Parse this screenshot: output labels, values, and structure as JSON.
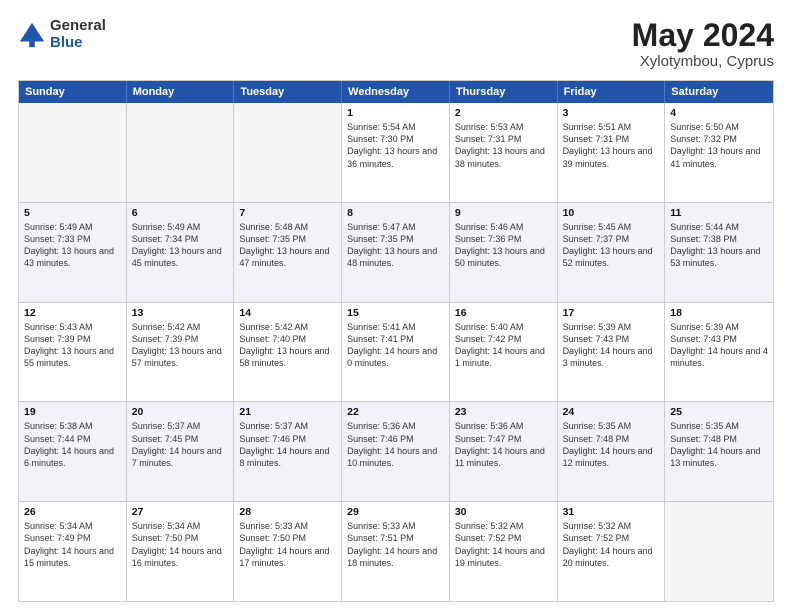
{
  "logo": {
    "general": "General",
    "blue": "Blue"
  },
  "title": {
    "month": "May 2024",
    "location": "Xylotymbou, Cyprus"
  },
  "header_days": [
    "Sunday",
    "Monday",
    "Tuesday",
    "Wednesday",
    "Thursday",
    "Friday",
    "Saturday"
  ],
  "rows": [
    {
      "alt": false,
      "cells": [
        {
          "day": "",
          "sunrise": "",
          "sunset": "",
          "daylight": "",
          "empty": true
        },
        {
          "day": "",
          "sunrise": "",
          "sunset": "",
          "daylight": "",
          "empty": true
        },
        {
          "day": "",
          "sunrise": "",
          "sunset": "",
          "daylight": "",
          "empty": true
        },
        {
          "day": "1",
          "sunrise": "Sunrise: 5:54 AM",
          "sunset": "Sunset: 7:30 PM",
          "daylight": "Daylight: 13 hours and 36 minutes.",
          "empty": false
        },
        {
          "day": "2",
          "sunrise": "Sunrise: 5:53 AM",
          "sunset": "Sunset: 7:31 PM",
          "daylight": "Daylight: 13 hours and 38 minutes.",
          "empty": false
        },
        {
          "day": "3",
          "sunrise": "Sunrise: 5:51 AM",
          "sunset": "Sunset: 7:31 PM",
          "daylight": "Daylight: 13 hours and 39 minutes.",
          "empty": false
        },
        {
          "day": "4",
          "sunrise": "Sunrise: 5:50 AM",
          "sunset": "Sunset: 7:32 PM",
          "daylight": "Daylight: 13 hours and 41 minutes.",
          "empty": false
        }
      ]
    },
    {
      "alt": true,
      "cells": [
        {
          "day": "5",
          "sunrise": "Sunrise: 5:49 AM",
          "sunset": "Sunset: 7:33 PM",
          "daylight": "Daylight: 13 hours and 43 minutes.",
          "empty": false
        },
        {
          "day": "6",
          "sunrise": "Sunrise: 5:49 AM",
          "sunset": "Sunset: 7:34 PM",
          "daylight": "Daylight: 13 hours and 45 minutes.",
          "empty": false
        },
        {
          "day": "7",
          "sunrise": "Sunrise: 5:48 AM",
          "sunset": "Sunset: 7:35 PM",
          "daylight": "Daylight: 13 hours and 47 minutes.",
          "empty": false
        },
        {
          "day": "8",
          "sunrise": "Sunrise: 5:47 AM",
          "sunset": "Sunset: 7:35 PM",
          "daylight": "Daylight: 13 hours and 48 minutes.",
          "empty": false
        },
        {
          "day": "9",
          "sunrise": "Sunrise: 5:46 AM",
          "sunset": "Sunset: 7:36 PM",
          "daylight": "Daylight: 13 hours and 50 minutes.",
          "empty": false
        },
        {
          "day": "10",
          "sunrise": "Sunrise: 5:45 AM",
          "sunset": "Sunset: 7:37 PM",
          "daylight": "Daylight: 13 hours and 52 minutes.",
          "empty": false
        },
        {
          "day": "11",
          "sunrise": "Sunrise: 5:44 AM",
          "sunset": "Sunset: 7:38 PM",
          "daylight": "Daylight: 13 hours and 53 minutes.",
          "empty": false
        }
      ]
    },
    {
      "alt": false,
      "cells": [
        {
          "day": "12",
          "sunrise": "Sunrise: 5:43 AM",
          "sunset": "Sunset: 7:39 PM",
          "daylight": "Daylight: 13 hours and 55 minutes.",
          "empty": false
        },
        {
          "day": "13",
          "sunrise": "Sunrise: 5:42 AM",
          "sunset": "Sunset: 7:39 PM",
          "daylight": "Daylight: 13 hours and 57 minutes.",
          "empty": false
        },
        {
          "day": "14",
          "sunrise": "Sunrise: 5:42 AM",
          "sunset": "Sunset: 7:40 PM",
          "daylight": "Daylight: 13 hours and 58 minutes.",
          "empty": false
        },
        {
          "day": "15",
          "sunrise": "Sunrise: 5:41 AM",
          "sunset": "Sunset: 7:41 PM",
          "daylight": "Daylight: 14 hours and 0 minutes.",
          "empty": false
        },
        {
          "day": "16",
          "sunrise": "Sunrise: 5:40 AM",
          "sunset": "Sunset: 7:42 PM",
          "daylight": "Daylight: 14 hours and 1 minute.",
          "empty": false
        },
        {
          "day": "17",
          "sunrise": "Sunrise: 5:39 AM",
          "sunset": "Sunset: 7:43 PM",
          "daylight": "Daylight: 14 hours and 3 minutes.",
          "empty": false
        },
        {
          "day": "18",
          "sunrise": "Sunrise: 5:39 AM",
          "sunset": "Sunset: 7:43 PM",
          "daylight": "Daylight: 14 hours and 4 minutes.",
          "empty": false
        }
      ]
    },
    {
      "alt": true,
      "cells": [
        {
          "day": "19",
          "sunrise": "Sunrise: 5:38 AM",
          "sunset": "Sunset: 7:44 PM",
          "daylight": "Daylight: 14 hours and 6 minutes.",
          "empty": false
        },
        {
          "day": "20",
          "sunrise": "Sunrise: 5:37 AM",
          "sunset": "Sunset: 7:45 PM",
          "daylight": "Daylight: 14 hours and 7 minutes.",
          "empty": false
        },
        {
          "day": "21",
          "sunrise": "Sunrise: 5:37 AM",
          "sunset": "Sunset: 7:46 PM",
          "daylight": "Daylight: 14 hours and 8 minutes.",
          "empty": false
        },
        {
          "day": "22",
          "sunrise": "Sunrise: 5:36 AM",
          "sunset": "Sunset: 7:46 PM",
          "daylight": "Daylight: 14 hours and 10 minutes.",
          "empty": false
        },
        {
          "day": "23",
          "sunrise": "Sunrise: 5:36 AM",
          "sunset": "Sunset: 7:47 PM",
          "daylight": "Daylight: 14 hours and 11 minutes.",
          "empty": false
        },
        {
          "day": "24",
          "sunrise": "Sunrise: 5:35 AM",
          "sunset": "Sunset: 7:48 PM",
          "daylight": "Daylight: 14 hours and 12 minutes.",
          "empty": false
        },
        {
          "day": "25",
          "sunrise": "Sunrise: 5:35 AM",
          "sunset": "Sunset: 7:48 PM",
          "daylight": "Daylight: 14 hours and 13 minutes.",
          "empty": false
        }
      ]
    },
    {
      "alt": false,
      "cells": [
        {
          "day": "26",
          "sunrise": "Sunrise: 5:34 AM",
          "sunset": "Sunset: 7:49 PM",
          "daylight": "Daylight: 14 hours and 15 minutes.",
          "empty": false
        },
        {
          "day": "27",
          "sunrise": "Sunrise: 5:34 AM",
          "sunset": "Sunset: 7:50 PM",
          "daylight": "Daylight: 14 hours and 16 minutes.",
          "empty": false
        },
        {
          "day": "28",
          "sunrise": "Sunrise: 5:33 AM",
          "sunset": "Sunset: 7:50 PM",
          "daylight": "Daylight: 14 hours and 17 minutes.",
          "empty": false
        },
        {
          "day": "29",
          "sunrise": "Sunrise: 5:33 AM",
          "sunset": "Sunset: 7:51 PM",
          "daylight": "Daylight: 14 hours and 18 minutes.",
          "empty": false
        },
        {
          "day": "30",
          "sunrise": "Sunrise: 5:32 AM",
          "sunset": "Sunset: 7:52 PM",
          "daylight": "Daylight: 14 hours and 19 minutes.",
          "empty": false
        },
        {
          "day": "31",
          "sunrise": "Sunrise: 5:32 AM",
          "sunset": "Sunset: 7:52 PM",
          "daylight": "Daylight: 14 hours and 20 minutes.",
          "empty": false
        },
        {
          "day": "",
          "sunrise": "",
          "sunset": "",
          "daylight": "",
          "empty": true
        }
      ]
    }
  ]
}
